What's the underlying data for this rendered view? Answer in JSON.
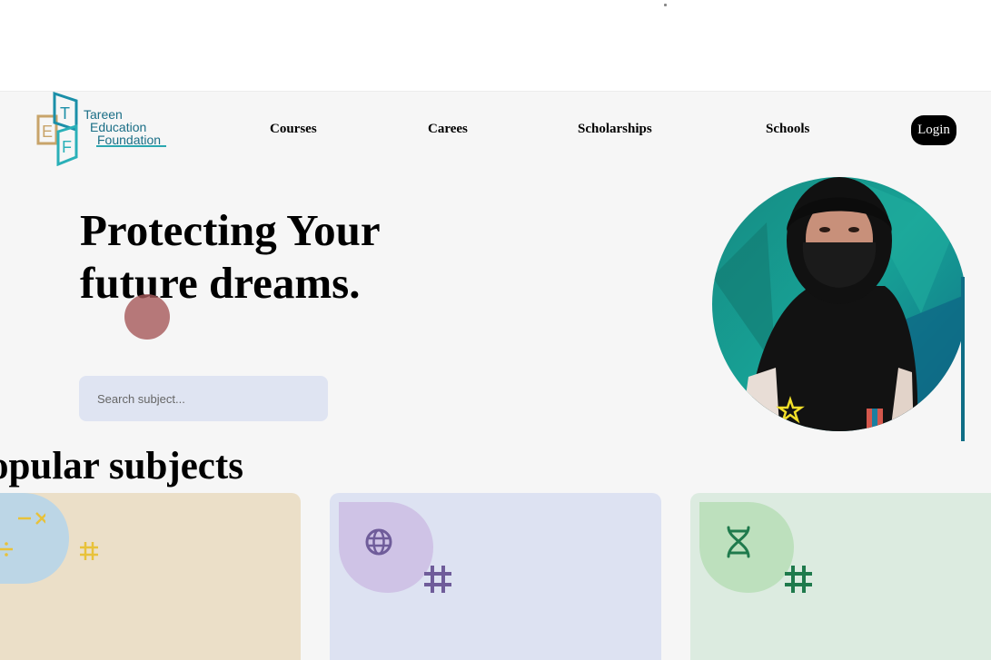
{
  "logo": {
    "letters": [
      "E",
      "T",
      "F"
    ],
    "line1": "Tareen",
    "line2": "Education",
    "line3": "Foundation"
  },
  "nav": {
    "courses": "Courses",
    "carees": "Carees",
    "scholarships": "Scholarships",
    "schools": "Schools",
    "login": "Login"
  },
  "hero": {
    "title": "Protecting Your future dreams.",
    "search_placeholder": "Search subject..."
  },
  "popular": {
    "title": "opular subjects",
    "cards": [
      {
        "icon": "math-operators-icon",
        "accent": "#e8c23a",
        "blob": "#bcd6e6"
      },
      {
        "icon": "globe-icon",
        "accent": "#6f5c9a",
        "blob": "#cfc3e6"
      },
      {
        "icon": "dna-icon",
        "accent": "#1f7a4c",
        "blob": "#bde0bd"
      }
    ]
  },
  "colors": {
    "background": "#f6f6f6",
    "brand": "#1a6e86",
    "login_bg": "#000000"
  }
}
